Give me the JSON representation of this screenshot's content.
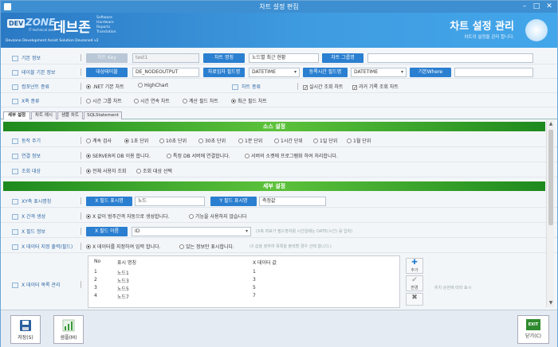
{
  "window": {
    "title": "차트 설정 편집",
    "min": "–",
    "max": "□",
    "close": "✕"
  },
  "banner": {
    "logo_dev": "DEV",
    "logo_zone": "ZONE",
    "logo_sub": "IT technical zone",
    "logo_kor": "데브존",
    "logo_words": [
      "Software",
      "Hardware",
      "Reports",
      "Translation"
    ],
    "company": "Devzone Development Assist Solution Devzone4 v2",
    "page_title": "차트 설정 관리",
    "page_desc": "차트의 설정을 관리 합니다."
  },
  "form": {
    "basic": {
      "label": "기본 정보",
      "chart_key_btn": "차트 Key",
      "chart_key_value": "test1",
      "chart_name_btn": "차트 명칭",
      "chart_name_value": "노드별 최근 현황",
      "group_btn": "차트 그룹명",
      "group_value": ""
    },
    "table": {
      "label": "테이블 기본 정보",
      "target_table_btn": "대상테이블",
      "target_table_value": "DE_NODEOUTPUT",
      "time_field_btn": "자료입자 필드명",
      "time_field_value": "DATETIME",
      "reg_time_btn": "등록시간 필드명",
      "reg_time_value": "DATETIME",
      "where_btn": "기본Where",
      "where_value": ""
    },
    "component": {
      "label": "컴포넌트 종류",
      "opt1": ".NET 기본 차트",
      "opt2": "HighChart",
      "kind_label": "차트 종류",
      "chk1": "실시간 조회 차트",
      "chk2": "과거 기록 조회 차트"
    },
    "xtype": {
      "label": "X축 종류",
      "opt1": "시간 그룹 차트",
      "opt2": "시간 연속 차트",
      "opt3": "계산 필드 차트",
      "opt4": "최근 필드 차트"
    }
  },
  "tabs": [
    "세부 설정",
    "차트 예시",
    "샘플 차트",
    "SQLStatement"
  ],
  "source": {
    "header": "소스 설정",
    "poll": {
      "label": "동작 주기",
      "options": [
        "계속 검사",
        "1초 단위",
        "10초 단위",
        "30초 단위",
        "1분 단위",
        "1시간 단위",
        "1일 단위",
        "1월 단위"
      ]
    },
    "conn": {
      "label": "연결 정보",
      "options": [
        "SERVER의 DB 이용 합니다.",
        "특정 DB 서버에 연결합니다.",
        "서버의 소켓에 프로그램화 하여 처리합니다."
      ]
    },
    "target": {
      "label": "조회 대상",
      "options": [
        "전체 사용자 조회",
        "조회 대상 선택"
      ]
    }
  },
  "detail": {
    "header": "세부 설정",
    "xy": {
      "label": "XY축 표시명칭",
      "x_btn": "X 필드 표시명",
      "x_value": "노드",
      "y_btn": "Y 필드 표시명",
      "y_value": "측정값"
    },
    "xinterval": {
      "label": "X 간격 생성",
      "options": [
        "X 값이 범주간격 자동으로 생성합니다.",
        "기능을 사용하지 않습니다"
      ]
    },
    "xfield": {
      "label": "X 필드 정보",
      "btn": "X 필드 이름",
      "value": "ID",
      "hint": "(X축 좌표가 필드명처럼 시간일때는 DATE(시간) 를 입력)"
    },
    "xdata": {
      "label": "X 데이터 지정 출력(필드)",
      "options": [
        "X 데이터를 지정하여 입력 합니다.",
        "있는 정보만 표시합니다."
      ],
      "hint": "(X 값을 정하여 목록을 출력할 경우 선택 합니다.)"
    },
    "xlist": {
      "label": "X 데이터 목록 관리",
      "columns": [
        "No",
        "표시 명칭",
        "X 데이터 값"
      ],
      "rows": [
        {
          "no": "1",
          "name": "노드1",
          "value": "1"
        },
        {
          "no": "2",
          "name": "노드3",
          "value": "3"
        },
        {
          "no": "3",
          "name": "노드5",
          "value": "5"
        },
        {
          "no": "4",
          "name": "노드7",
          "value": "7"
        }
      ],
      "add": "추가",
      "edit": "변경",
      "del": "삭제",
      "sort_hint": "위치 순번에 따라 표시"
    }
  },
  "bottom": {
    "save": "저장(S)",
    "sample": "샘플(M)",
    "close": "닫기(C)",
    "exit_icon": "EXIT"
  }
}
